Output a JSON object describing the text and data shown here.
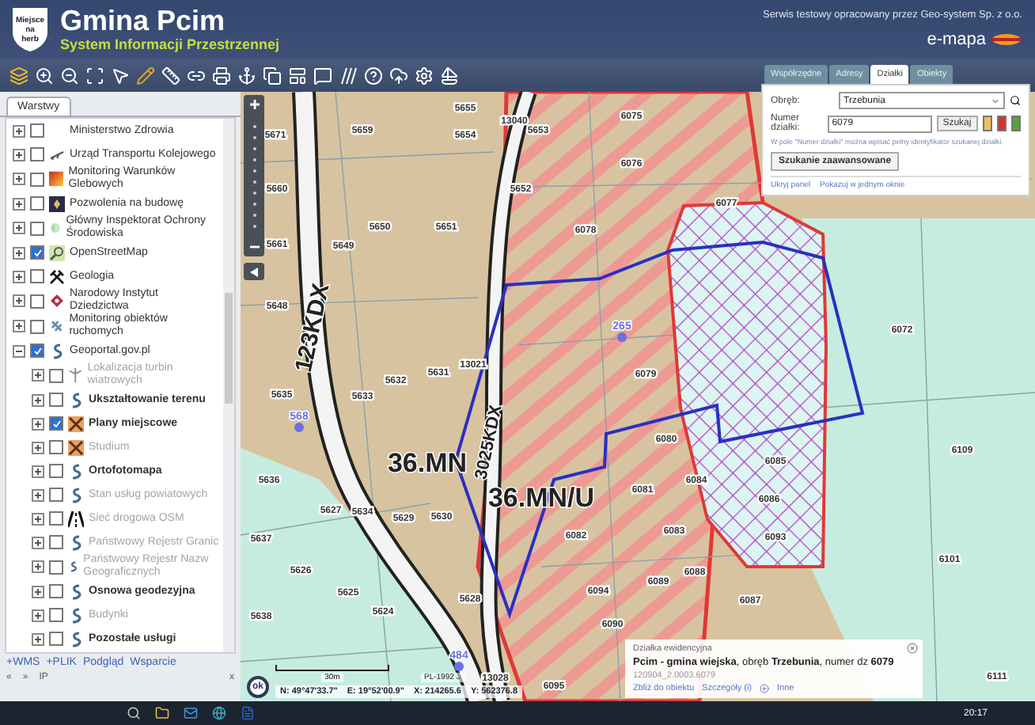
{
  "header": {
    "logo_text": "Miejsce na herb",
    "title": "Gmina Pcim",
    "subtitle": "System Informacji Przestrzennej",
    "provider": "Serwis testowy opracowany przez Geo-system Sp. z o.o.",
    "brand": "e-mapa"
  },
  "layers_panel": {
    "tab": "Warstwy",
    "layers": [
      {
        "name": "Ministerstwo Zdrowia",
        "checked": false,
        "expanded": false,
        "disabled": false
      },
      {
        "name": "Urząd Transportu Kolejowego",
        "checked": false,
        "expanded": false,
        "disabled": false
      },
      {
        "name": "Monitoring Warunków Glebowych",
        "checked": false,
        "expanded": false,
        "disabled": false
      },
      {
        "name": "Pozwolenia na budowę",
        "checked": false,
        "expanded": false,
        "disabled": false
      },
      {
        "name": "Główny Inspektorat Ochrony Środowiska",
        "checked": false,
        "expanded": false,
        "disabled": false
      },
      {
        "name": "OpenStreetMap",
        "checked": true,
        "expanded": false,
        "disabled": false
      },
      {
        "name": "Geologia",
        "checked": false,
        "expanded": false,
        "disabled": false
      },
      {
        "name": "Narodowy Instytut Dziedzictwa",
        "checked": false,
        "expanded": false,
        "disabled": false
      },
      {
        "name": "Monitoring obiektów ruchomych",
        "checked": false,
        "expanded": false,
        "disabled": false
      },
      {
        "name": "Geoportal.gov.pl",
        "checked": true,
        "expanded": true,
        "disabled": false,
        "children": [
          {
            "name": "Lokalizacja turbin wiatrowych",
            "checked": false,
            "expanded": false,
            "disabled": true
          },
          {
            "name": "Ukształtowanie terenu",
            "checked": false,
            "expanded": false,
            "disabled": false
          },
          {
            "name": "Plany miejscowe",
            "checked": true,
            "expanded": false,
            "disabled": false
          },
          {
            "name": "Studium",
            "checked": false,
            "expanded": false,
            "disabled": true
          },
          {
            "name": "Ortofotomapa",
            "checked": false,
            "expanded": false,
            "disabled": false
          },
          {
            "name": "Stan usług powiatowych",
            "checked": false,
            "expanded": false,
            "disabled": true
          },
          {
            "name": "Sieć drogowa OSM",
            "checked": false,
            "expanded": false,
            "disabled": true
          },
          {
            "name": "Państwowy Rejestr Granic",
            "checked": false,
            "expanded": false,
            "disabled": true
          },
          {
            "name": "Państwowy Rejestr Nazw Geograficznych",
            "checked": false,
            "expanded": false,
            "disabled": true
          },
          {
            "name": "Osnowa geodezyjna",
            "checked": false,
            "expanded": false,
            "disabled": false
          },
          {
            "name": "Budynki",
            "checked": false,
            "expanded": false,
            "disabled": true
          },
          {
            "name": "Pozostałe usługi",
            "checked": false,
            "expanded": false,
            "disabled": false
          }
        ]
      }
    ],
    "footer_links": [
      "+WMS",
      "+PLIK",
      "Podgląd",
      "Wsparcie"
    ],
    "footer_controls": [
      "«",
      "»",
      "IP",
      "x"
    ]
  },
  "search_panel": {
    "tabs": [
      {
        "label": "Współrzędne",
        "selected": false
      },
      {
        "label": "Adresy",
        "selected": false
      },
      {
        "label": "Działki",
        "selected": true
      },
      {
        "label": "Obiekty",
        "selected": false
      }
    ],
    "precinct_label": "Obręb:",
    "precinct_value": "Trzebunia",
    "parcel_label": "Numer działki:",
    "parcel_value": "6079",
    "search_button": "Szukaj",
    "colors": [
      {
        "color": "#f0c060"
      },
      {
        "color": "#d83030"
      },
      {
        "color": "#5aa040"
      }
    ],
    "hint": "W pole \"Numer działki\" można wpisać pełny identyfikator szukanej działki.",
    "advanced_button": "Szukanie zaawansowane",
    "links": [
      "Ukryj panel",
      "Pokazuj w jednym oknie"
    ]
  },
  "map": {
    "labels": [
      {
        "kind": "parcel",
        "label": "5655"
      },
      {
        "kind": "parcel",
        "label": "13040"
      },
      {
        "kind": "parcel",
        "label": "5653"
      },
      {
        "kind": "parcel",
        "label": "5654"
      },
      {
        "kind": "parcel",
        "label": "6075"
      },
      {
        "kind": "parcel",
        "label": "5659"
      },
      {
        "kind": "parcel",
        "label": "5671"
      },
      {
        "kind": "parcel",
        "label": "6076"
      },
      {
        "kind": "parcel",
        "label": "5652"
      },
      {
        "kind": "parcel",
        "label": "5660"
      },
      {
        "kind": "parcel",
        "label": "6077"
      },
      {
        "kind": "parcel",
        "label": "5650"
      },
      {
        "kind": "parcel",
        "label": "5651"
      },
      {
        "kind": "parcel",
        "label": "6078"
      },
      {
        "kind": "parcel",
        "label": "5661"
      },
      {
        "kind": "parcel",
        "label": "5649"
      },
      {
        "kind": "parcel",
        "label": "5648"
      },
      {
        "kind": "point",
        "label": "265"
      },
      {
        "kind": "parcel",
        "label": "6079"
      },
      {
        "kind": "parcel",
        "label": "5632"
      },
      {
        "kind": "parcel",
        "label": "5631"
      },
      {
        "kind": "parcel",
        "label": "13021"
      },
      {
        "kind": "parcel",
        "label": "5633"
      },
      {
        "kind": "parcel",
        "label": "5635"
      },
      {
        "kind": "point",
        "label": "568"
      },
      {
        "kind": "parcel",
        "label": "6080"
      },
      {
        "kind": "parcel",
        "label": "6084"
      },
      {
        "kind": "parcel",
        "label": "6081"
      },
      {
        "kind": "parcel",
        "label": "5636"
      },
      {
        "kind": "parcel",
        "label": "5627"
      },
      {
        "kind": "parcel",
        "label": "5634"
      },
      {
        "kind": "parcel",
        "label": "5629"
      },
      {
        "kind": "parcel",
        "label": "5630"
      },
      {
        "kind": "parcel",
        "label": "6083"
      },
      {
        "kind": "parcel",
        "label": "6082"
      },
      {
        "kind": "parcel",
        "label": "5637"
      },
      {
        "kind": "parcel",
        "label": "5626"
      },
      {
        "kind": "parcel",
        "label": "6088"
      },
      {
        "kind": "parcel",
        "label": "6089"
      },
      {
        "kind": "parcel",
        "label": "5625"
      },
      {
        "kind": "parcel",
        "label": "6094"
      },
      {
        "kind": "parcel",
        "label": "5628"
      },
      {
        "kind": "parcel",
        "label": "5624"
      },
      {
        "kind": "parcel",
        "label": "6087"
      },
      {
        "kind": "parcel",
        "label": "5638"
      },
      {
        "kind": "parcel",
        "label": "6090"
      },
      {
        "kind": "parcel",
        "label": "6072"
      },
      {
        "kind": "parcel",
        "label": "6085"
      },
      {
        "kind": "parcel",
        "label": "6086"
      },
      {
        "kind": "parcel",
        "label": "6109"
      },
      {
        "kind": "parcel",
        "label": "6093"
      },
      {
        "kind": "parcel",
        "label": "6101"
      },
      {
        "kind": "parcel",
        "label": "6095"
      },
      {
        "kind": "parcel",
        "label": "13028"
      },
      {
        "kind": "parcel",
        "label": "6111"
      },
      {
        "kind": "point",
        "label": "484"
      },
      {
        "kind": "road",
        "label": "123KDX"
      },
      {
        "kind": "road",
        "label": "3025KDX"
      },
      {
        "kind": "zone",
        "label": "36.MN"
      },
      {
        "kind": "zone",
        "label": "36.MN/U"
      }
    ],
    "scale": "30m",
    "projection": "PL-1992",
    "ok_button": "ok",
    "coordinates": [
      "N: 49°47'33.7\"",
      "E: 19°52'00.9\"",
      "X: 214265.6",
      "Y: 562376.8"
    ],
    "popup": {
      "title": "Działka ewidencyjna",
      "text": "**Pcim - gmina wiejska**, obręb **Trzebunia**, numer dz **6079**",
      "id": "120904_2.0003.6079",
      "links": [
        "Zbliż do obiektu",
        "Szczegóły (i)",
        "Inne"
      ]
    }
  },
  "taskbar": {
    "time": "20:17"
  }
}
